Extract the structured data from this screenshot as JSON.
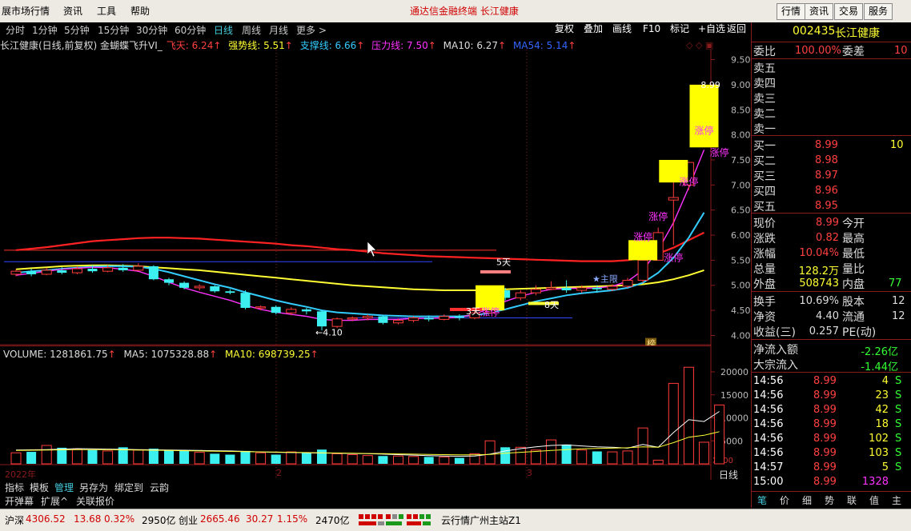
{
  "menu": {
    "items": [
      "展市场行情",
      "资讯",
      "工具",
      "帮助"
    ],
    "center_title": "通达信金融终端    长江健康",
    "right_buttons": [
      "行情",
      "资讯",
      "交易",
      "服务"
    ]
  },
  "periods": {
    "items": [
      "分时",
      "1分钟",
      "5分钟",
      "15分钟",
      "30分钟",
      "60分钟",
      "日线",
      "周线",
      "月线",
      "更多 >"
    ],
    "active": "日线"
  },
  "tools": [
    "复权",
    "叠加",
    "画线",
    "F10",
    "标记",
    "+自选",
    "返回"
  ],
  "indicator": {
    "name": "长江健康(日线,前复权) 金蝴蝶飞升VI_",
    "feitian": "飞天: 6.24",
    "qiangshi": "强势线: 5.51",
    "zhicheng": "支撑线: 6.66",
    "yali": "压力线: 7.50",
    "ma10": "MA10: 6.27",
    "ma54": "MA54: 5.14"
  },
  "chart_data": [
    {
      "type": "candlestick",
      "title": "长江健康(日线,前复权) 金蝴蝶飞升VI_",
      "ylim": [
        3.8,
        9.7
      ],
      "yticks": [
        "9.50",
        "9.00",
        "8.50",
        "8.00",
        "7.50",
        "7.00",
        "6.50",
        "6.00",
        "5.50",
        "5.00",
        "4.50",
        "4.00"
      ],
      "ytick_values": [
        9.5,
        9.0,
        8.5,
        8.0,
        7.5,
        7.0,
        6.5,
        6.0,
        5.5,
        5.0,
        4.5,
        4.0
      ],
      "candles": [
        {
          "o": 5.22,
          "c": 5.28,
          "h": 5.32,
          "l": 5.18
        },
        {
          "o": 5.28,
          "c": 5.22,
          "h": 5.33,
          "l": 5.18
        },
        {
          "o": 5.22,
          "c": 5.3,
          "h": 5.35,
          "l": 5.2
        },
        {
          "o": 5.3,
          "c": 5.25,
          "h": 5.36,
          "l": 5.22
        },
        {
          "o": 5.25,
          "c": 5.33,
          "h": 5.38,
          "l": 5.22
        },
        {
          "o": 5.33,
          "c": 5.28,
          "h": 5.4,
          "l": 5.25
        },
        {
          "o": 5.28,
          "c": 5.35,
          "h": 5.4,
          "l": 5.26
        },
        {
          "o": 5.35,
          "c": 5.3,
          "h": 5.42,
          "l": 5.27
        },
        {
          "o": 5.3,
          "c": 5.38,
          "h": 5.44,
          "l": 5.28
        },
        {
          "o": 5.38,
          "c": 5.12,
          "h": 5.4,
          "l": 5.1
        },
        {
          "o": 5.12,
          "c": 5.05,
          "h": 5.15,
          "l": 5.0
        },
        {
          "o": 5.05,
          "c": 4.95,
          "h": 5.08,
          "l": 4.92
        },
        {
          "o": 4.95,
          "c": 4.98,
          "h": 5.02,
          "l": 4.9
        },
        {
          "o": 4.98,
          "c": 4.88,
          "h": 5.0,
          "l": 4.85
        },
        {
          "o": 4.88,
          "c": 4.85,
          "h": 4.92,
          "l": 4.82
        },
        {
          "o": 4.85,
          "c": 4.55,
          "h": 4.9,
          "l": 4.52
        },
        {
          "o": 4.55,
          "c": 4.57,
          "h": 4.6,
          "l": 4.5
        },
        {
          "o": 4.57,
          "c": 4.45,
          "h": 4.6,
          "l": 4.42
        },
        {
          "o": 4.45,
          "c": 4.52,
          "h": 4.56,
          "l": 4.4
        },
        {
          "o": 4.52,
          "c": 4.48,
          "h": 4.55,
          "l": 4.42
        },
        {
          "o": 4.48,
          "c": 4.18,
          "h": 4.5,
          "l": 4.1
        },
        {
          "o": 4.18,
          "c": 4.33,
          "h": 4.36,
          "l": 4.15
        },
        {
          "o": 4.33,
          "c": 4.35,
          "h": 4.38,
          "l": 4.28
        },
        {
          "o": 4.35,
          "c": 4.38,
          "h": 4.42,
          "l": 4.3
        },
        {
          "o": 4.38,
          "c": 4.25,
          "h": 4.4,
          "l": 4.22
        },
        {
          "o": 4.25,
          "c": 4.3,
          "h": 4.34,
          "l": 4.22
        },
        {
          "o": 4.3,
          "c": 4.35,
          "h": 4.38,
          "l": 4.26
        },
        {
          "o": 4.35,
          "c": 4.32,
          "h": 4.4,
          "l": 4.28
        },
        {
          "o": 4.32,
          "c": 4.38,
          "h": 4.42,
          "l": 4.3
        },
        {
          "o": 4.38,
          "c": 4.35,
          "h": 4.42,
          "l": 4.3
        },
        {
          "o": 4.35,
          "c": 4.45,
          "h": 4.5,
          "l": 4.32
        },
        {
          "o": 4.45,
          "c": 4.9,
          "h": 4.9,
          "l": 4.43
        },
        {
          "o": 4.9,
          "c": 4.75,
          "h": 4.95,
          "l": 4.7
        },
        {
          "o": 4.75,
          "c": 4.85,
          "h": 4.9,
          "l": 4.7
        },
        {
          "o": 4.85,
          "c": 4.92,
          "h": 5.0,
          "l": 4.8
        },
        {
          "o": 4.92,
          "c": 4.95,
          "h": 5.08,
          "l": 4.9
        },
        {
          "o": 4.95,
          "c": 4.9,
          "h": 5.1,
          "l": 4.85
        },
        {
          "o": 4.9,
          "c": 4.95,
          "h": 5.0,
          "l": 4.85
        },
        {
          "o": 4.95,
          "c": 4.92,
          "h": 5.0,
          "l": 4.85
        },
        {
          "o": 4.92,
          "c": 4.98,
          "h": 5.02,
          "l": 4.88
        },
        {
          "o": 4.98,
          "c": 5.1,
          "h": 5.15,
          "l": 4.95
        },
        {
          "o": 5.1,
          "c": 5.5,
          "h": 5.5,
          "l": 5.05
        },
        {
          "o": 5.5,
          "c": 6.05,
          "h": 6.15,
          "l": 5.55
        },
        {
          "o": 6.7,
          "c": 6.75,
          "h": 7.35,
          "l": 5.8
        },
        {
          "o": 7.0,
          "c": 7.45,
          "h": 7.45,
          "l": 6.9
        },
        {
          "o": 8.0,
          "c": 8.99,
          "h": 8.99,
          "l": 7.8
        }
      ],
      "lines": {
        "red": [
          5.7,
          5.73,
          5.76,
          5.8,
          5.84,
          5.88,
          5.9,
          5.92,
          5.94,
          5.95,
          5.95,
          5.94,
          5.93,
          5.91,
          5.89,
          5.87,
          5.85,
          5.83,
          5.8,
          5.78,
          5.75,
          5.72,
          5.7,
          5.67,
          5.64,
          5.62,
          5.6,
          5.58,
          5.57,
          5.56,
          5.55,
          5.54,
          5.53,
          5.52,
          5.51,
          5.5,
          5.49,
          5.48,
          5.48,
          5.48,
          5.5,
          5.55,
          5.63,
          5.75,
          5.9,
          6.05
        ],
        "yellow": [
          5.32,
          5.34,
          5.36,
          5.38,
          5.39,
          5.4,
          5.4,
          5.39,
          5.38,
          5.36,
          5.34,
          5.32,
          5.3,
          5.27,
          5.24,
          5.21,
          5.18,
          5.15,
          5.12,
          5.09,
          5.06,
          5.03,
          5.0,
          4.98,
          4.96,
          4.94,
          4.92,
          4.91,
          4.9,
          4.9,
          4.9,
          4.91,
          4.92,
          4.93,
          4.94,
          4.95,
          4.96,
          4.97,
          4.98,
          4.99,
          5.0,
          5.02,
          5.06,
          5.12,
          5.2,
          5.3
        ],
        "cyan": [
          5.25,
          5.28,
          5.3,
          5.33,
          5.35,
          5.37,
          5.38,
          5.38,
          5.37,
          5.33,
          5.26,
          5.18,
          5.1,
          5.02,
          4.95,
          4.86,
          4.78,
          4.7,
          4.63,
          4.57,
          4.5,
          4.46,
          4.44,
          4.42,
          4.4,
          4.39,
          4.38,
          4.38,
          4.38,
          4.38,
          4.4,
          4.45,
          4.52,
          4.6,
          4.68,
          4.74,
          4.8,
          4.84,
          4.87,
          4.9,
          4.95,
          5.05,
          5.25,
          5.55,
          5.95,
          6.45
        ],
        "magenta": [
          5.2,
          5.24,
          5.28,
          5.32,
          5.34,
          5.36,
          5.35,
          5.32,
          5.28,
          5.18,
          5.06,
          4.95,
          4.86,
          4.78,
          4.7,
          4.6,
          4.52,
          4.46,
          4.42,
          4.38,
          4.32,
          4.3,
          4.3,
          4.32,
          4.32,
          4.32,
          4.34,
          4.34,
          4.35,
          4.36,
          4.42,
          4.55,
          4.68,
          4.78,
          4.86,
          4.92,
          4.94,
          4.94,
          4.95,
          4.98,
          5.08,
          5.3,
          5.7,
          6.25,
          6.95,
          7.7
        ]
      },
      "annotations": {
        "high_label": "8.99",
        "low_label": "←4.10",
        "zhangting": "涨停",
        "days_5": "5天",
        "days_3": "3天",
        "days_8": "8天",
        "zhuli": "★主限",
        "bang": "榜"
      }
    },
    {
      "type": "bar",
      "title": "VOLUME: 1281861.75",
      "ma5_label": "MA5: 1075328.88",
      "ma10_label": "MA10: 698739.25",
      "ylim": [
        0,
        24000
      ],
      "yticks": [
        "20000",
        "15000",
        "10000",
        "5000"
      ],
      "ytick_values": [
        20000,
        15000,
        10000,
        5000
      ],
      "unit_label": "X100",
      "values": [
        2400,
        2600,
        4000,
        3500,
        3200,
        3000,
        2800,
        3600,
        3000,
        3300,
        3000,
        2800,
        2500,
        2200,
        2000,
        2800,
        2400,
        2000,
        2600,
        2400,
        3100,
        2200,
        2000,
        1800,
        1700,
        1700,
        1600,
        1500,
        1500,
        1300,
        2200,
        5000,
        3600,
        3600,
        3000,
        5200,
        4200,
        3000,
        2700,
        2600,
        2800,
        7800,
        800,
        17500,
        21000,
        4700,
        12800
      ],
      "rising": [
        true,
        false,
        true,
        false,
        true,
        false,
        true,
        false,
        true,
        false,
        false,
        false,
        true,
        false,
        false,
        false,
        true,
        false,
        true,
        false,
        false,
        true,
        true,
        true,
        false,
        true,
        true,
        false,
        true,
        false,
        true,
        true,
        false,
        true,
        true,
        true,
        false,
        true,
        false,
        true,
        true,
        true,
        true,
        true,
        true,
        true,
        true
      ],
      "ma5": [
        3000,
        3050,
        3100,
        3200,
        3300,
        3250,
        3200,
        3150,
        3100,
        3050,
        3000,
        2950,
        2900,
        2850,
        2800,
        2700,
        2600,
        2500,
        2450,
        2400,
        2350,
        2300,
        2250,
        2200,
        2100,
        2000,
        1900,
        1800,
        1700,
        1650,
        1700,
        2100,
        2800,
        3300,
        3700,
        4000,
        4100,
        3900,
        3700,
        3600,
        3400,
        4200,
        3600,
        6800,
        9600,
        9200,
        11400
      ],
      "ma10": [
        2900,
        2950,
        3000,
        3050,
        3100,
        3100,
        3100,
        3050,
        3000,
        2950,
        2900,
        2850,
        2800,
        2750,
        2700,
        2650,
        2600,
        2550,
        2500,
        2450,
        2400,
        2350,
        2300,
        2250,
        2200,
        2150,
        2100,
        2050,
        2000,
        1950,
        1950,
        2050,
        2300,
        2500,
        2700,
        2900,
        3100,
        3250,
        3350,
        3400,
        3500,
        3700,
        3600,
        4600,
        5800,
        6200,
        7000
      ]
    }
  ],
  "xaxis": {
    "labels": [
      "2022年",
      "2",
      "3"
    ]
  },
  "right_axis_bottom": "日线",
  "right_axis_controls": [
    "+",
    "-",
    "0"
  ],
  "bottom_tabs": {
    "row1": [
      "指标",
      "模板",
      "管理",
      "另存为",
      "绑定到",
      "云韵"
    ],
    "active": "管理",
    "row2": [
      "开弹幕",
      "扩展^",
      "关联报价"
    ]
  },
  "quote": {
    "code": "002435",
    "name": "长江健康",
    "weibi_label": "委比",
    "weibi": "100.00%",
    "weicha_label": "委差",
    "weicha": "10",
    "sells": [
      {
        "label": "卖五",
        "price": "",
        "vol": ""
      },
      {
        "label": "卖四",
        "price": "",
        "vol": ""
      },
      {
        "label": "卖三",
        "price": "",
        "vol": ""
      },
      {
        "label": "卖二",
        "price": "",
        "vol": ""
      },
      {
        "label": "卖一",
        "price": "",
        "vol": ""
      }
    ],
    "buys": [
      {
        "label": "买一",
        "price": "8.99",
        "vol": "10"
      },
      {
        "label": "买二",
        "price": "8.98",
        "vol": ""
      },
      {
        "label": "买三",
        "price": "8.97",
        "vol": ""
      },
      {
        "label": "买四",
        "price": "8.96",
        "vol": ""
      },
      {
        "label": "买五",
        "price": "8.95",
        "vol": ""
      }
    ],
    "stats": [
      {
        "l1": "现价",
        "v1": "8.99",
        "l2": "今开",
        "v2": ""
      },
      {
        "l1": "涨跌",
        "v1": "0.82",
        "l2": "最高",
        "v2": ""
      },
      {
        "l1": "涨幅",
        "v1": "10.04%",
        "l2": "最低",
        "v2": ""
      },
      {
        "l1": "总量",
        "v1": "128.2万",
        "l2": "量比",
        "v2": ""
      },
      {
        "l1": "外盘",
        "v1": "508743",
        "l2": "内盘",
        "v2": "77"
      }
    ],
    "stats2": [
      {
        "l1": "换手",
        "v1": "10.69%",
        "l2": "股本",
        "v2": "12"
      },
      {
        "l1": "净资",
        "v1": "4.40",
        "l2": "流通",
        "v2": "12"
      },
      {
        "l1": "收益(三)",
        "v1": "0.257",
        "l2": "PE(动)",
        "v2": ""
      }
    ],
    "flow": [
      {
        "label": "净流入额",
        "value": "-2.26亿"
      },
      {
        "label": "大宗流入",
        "value": "-1.44亿"
      }
    ],
    "trades": [
      {
        "time": "14:56",
        "price": "8.99",
        "vol": "4",
        "flag": "S"
      },
      {
        "time": "14:56",
        "price": "8.99",
        "vol": "23",
        "flag": "S"
      },
      {
        "time": "14:56",
        "price": "8.99",
        "vol": "42",
        "flag": "S"
      },
      {
        "time": "14:56",
        "price": "8.99",
        "vol": "18",
        "flag": "S"
      },
      {
        "time": "14:56",
        "price": "8.99",
        "vol": "102",
        "flag": "S"
      },
      {
        "time": "14:56",
        "price": "8.99",
        "vol": "103",
        "flag": "S"
      },
      {
        "time": "14:57",
        "price": "8.99",
        "vol": "5",
        "flag": "S"
      },
      {
        "time": "15:00",
        "price": "8.99",
        "vol": "1328",
        "flag": ""
      }
    ],
    "panel_tabs": [
      "笔",
      "价",
      "细",
      "势",
      "联",
      "值",
      "主"
    ]
  },
  "status": {
    "sh_label": "沪深",
    "sh_index": "4306.52",
    "sh_change": "13.68",
    "sh_pct": "0.32%",
    "sh_amount": "2950亿",
    "cy_label": "创业",
    "cy_index": "2665.46",
    "cy_change": "30.27",
    "cy_pct": "1.15%",
    "cy_amount": "2470亿",
    "server": "云行情广州主站Z1"
  },
  "colors": {
    "up": "#ff3c3c",
    "down": "#3cf0f0",
    "yellow": "#ffff33",
    "magenta": "#ff33ff",
    "cyan": "#33ccff",
    "axis": "#8a1b1b",
    "text_red": "#ff4040",
    "text_green": "#33ff33"
  }
}
